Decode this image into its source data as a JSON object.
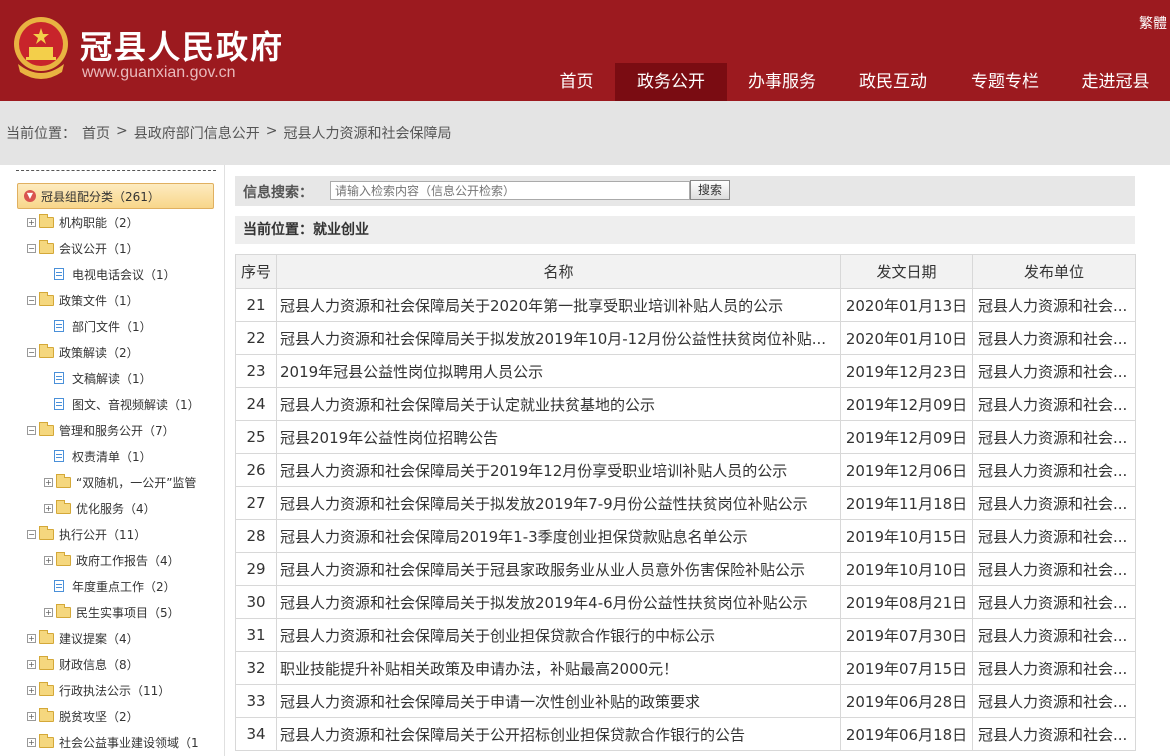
{
  "header": {
    "site_title": "冠县人民政府",
    "site_url": "www.guanxian.gov.cn",
    "traditional": "繁體",
    "nav": [
      {
        "label": "首页",
        "active": false
      },
      {
        "label": "政务公开",
        "active": true
      },
      {
        "label": "办事服务",
        "active": false
      },
      {
        "label": "政民互动",
        "active": false
      },
      {
        "label": "专题专栏",
        "active": false
      },
      {
        "label": "走进冠县",
        "active": false
      }
    ]
  },
  "breadcrumb": {
    "prefix": "当前位置：",
    "items": [
      "首页",
      "县政府部门信息公开",
      "冠县人力资源和社会保障局"
    ],
    "sep": ">"
  },
  "sidebar": {
    "root": "冠县组配分类（261）",
    "items": [
      {
        "label": "机构职能（2）",
        "type": "folder",
        "toggle": "+",
        "level": 0
      },
      {
        "label": "会议公开（1）",
        "type": "folder",
        "toggle": "-",
        "level": 0
      },
      {
        "label": "电视电话会议（1）",
        "type": "doc",
        "toggle": "",
        "level": 1
      },
      {
        "label": "政策文件（1）",
        "type": "folder",
        "toggle": "-",
        "level": 0
      },
      {
        "label": "部门文件（1）",
        "type": "doc",
        "toggle": "",
        "level": 1
      },
      {
        "label": "政策解读（2）",
        "type": "folder",
        "toggle": "-",
        "level": 0
      },
      {
        "label": "文稿解读（1）",
        "type": "doc",
        "toggle": "",
        "level": 1
      },
      {
        "label": "图文、音视频解读（1）",
        "type": "doc",
        "toggle": "",
        "level": 1
      },
      {
        "label": "管理和服务公开（7）",
        "type": "folder",
        "toggle": "-",
        "level": 0
      },
      {
        "label": "权责清单（1）",
        "type": "doc",
        "toggle": "",
        "level": 1
      },
      {
        "label": "“双随机，一公开”监管",
        "type": "folder",
        "toggle": "+",
        "level": 1
      },
      {
        "label": "优化服务（4）",
        "type": "folder",
        "toggle": "+",
        "level": 1
      },
      {
        "label": "执行公开（11）",
        "type": "folder",
        "toggle": "-",
        "level": 0
      },
      {
        "label": "政府工作报告（4）",
        "type": "folder",
        "toggle": "+",
        "level": 1
      },
      {
        "label": "年度重点工作（2）",
        "type": "doc",
        "toggle": "",
        "level": 1
      },
      {
        "label": "民生实事项目（5）",
        "type": "folder",
        "toggle": "+",
        "level": 1
      },
      {
        "label": "建议提案（4）",
        "type": "folder",
        "toggle": "+",
        "level": -1
      },
      {
        "label": "财政信息（8）",
        "type": "folder",
        "toggle": "+",
        "level": -1
      },
      {
        "label": "行政执法公示（11）",
        "type": "folder",
        "toggle": "+",
        "level": -1
      },
      {
        "label": "脱贫攻坚（2）",
        "type": "folder",
        "toggle": "+",
        "level": -1
      },
      {
        "label": "社会公益事业建设领域（1",
        "type": "folder",
        "toggle": "+",
        "level": -1
      }
    ]
  },
  "search": {
    "label": "信息搜索：",
    "placeholder": "请输入检索内容（信息公开检索）",
    "button": "搜索"
  },
  "location": "当前位置：就业创业",
  "table": {
    "headers": [
      "序号",
      "名称",
      "发文日期",
      "发布单位"
    ],
    "rows": [
      [
        "21",
        "冠县人力资源和社会保障局关于2020年第一批享受职业培训补贴人员的公示",
        "2020年01月13日",
        "冠县人力资源和社会..."
      ],
      [
        "22",
        "冠县人力资源和社会保障局关于拟发放2019年10月-12月份公益性扶贫岗位补贴...",
        "2020年01月10日",
        "冠县人力资源和社会..."
      ],
      [
        "23",
        "2019年冠县公益性岗位拟聘用人员公示",
        "2019年12月23日",
        "冠县人力资源和社会..."
      ],
      [
        "24",
        "冠县人力资源和社会保障局关于认定就业扶贫基地的公示",
        "2019年12月09日",
        "冠县人力资源和社会..."
      ],
      [
        "25",
        "冠县2019年公益性岗位招聘公告",
        "2019年12月09日",
        "冠县人力资源和社会..."
      ],
      [
        "26",
        "冠县人力资源和社会保障局关于2019年12月份享受职业培训补贴人员的公示",
        "2019年12月06日",
        "冠县人力资源和社会..."
      ],
      [
        "27",
        "冠县人力资源和社会保障局关于拟发放2019年7-9月份公益性扶贫岗位补贴公示",
        "2019年11月18日",
        "冠县人力资源和社会..."
      ],
      [
        "28",
        "冠县人力资源和社会保障局2019年1-3季度创业担保贷款贴息名单公示",
        "2019年10月15日",
        "冠县人力资源和社会..."
      ],
      [
        "29",
        "冠县人力资源和社会保障局关于冠县家政服务业从业人员意外伤害保险补贴公示",
        "2019年10月10日",
        "冠县人力资源和社会..."
      ],
      [
        "30",
        "冠县人力资源和社会保障局关于拟发放2019年4-6月份公益性扶贫岗位补贴公示",
        "2019年08月21日",
        "冠县人力资源和社会..."
      ],
      [
        "31",
        "冠县人力资源和社会保障局关于创业担保贷款合作银行的中标公示",
        "2019年07月30日",
        "冠县人力资源和社会..."
      ],
      [
        "32",
        "职业技能提升补贴相关政策及申请办法，补贴最高2000元！",
        "2019年07月15日",
        "冠县人力资源和社会..."
      ],
      [
        "33",
        "冠县人力资源和社会保障局关于申请一次性创业补贴的政策要求",
        "2019年06月28日",
        "冠县人力资源和社会..."
      ],
      [
        "34",
        "冠县人力资源和社会保障局关于公开招标创业担保贷款合作银行的公告",
        "2019年06月18日",
        "冠县人力资源和社会..."
      ]
    ]
  }
}
